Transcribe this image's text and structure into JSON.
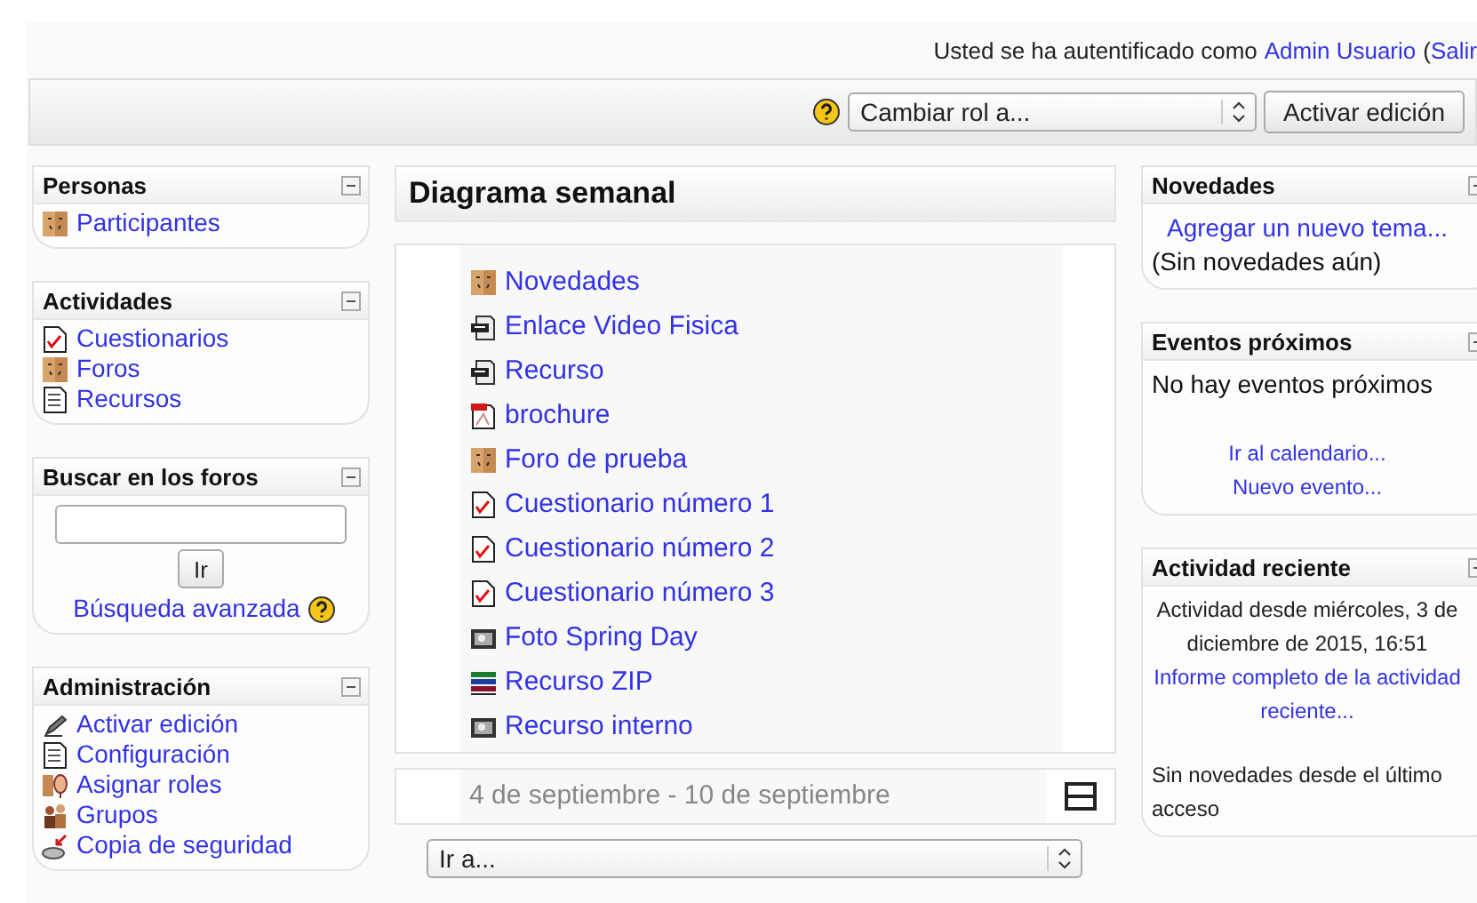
{
  "login": {
    "prefix": "Usted se ha autentificado como",
    "user": "Admin Usuario",
    "paren": "(",
    "logout": "Salir"
  },
  "toolbar": {
    "role_select": "Cambiar rol a...",
    "edit_button": "Activar edición"
  },
  "left_blocks": [
    {
      "title": "Personas",
      "kind": "links",
      "items": [
        {
          "label": "Participantes",
          "kind": "forum"
        }
      ]
    },
    {
      "title": "Actividades",
      "kind": "links",
      "items": [
        {
          "label": "Cuestionarios",
          "kind": "quiz"
        },
        {
          "label": "Foros",
          "kind": "forum"
        },
        {
          "label": "Recursos",
          "kind": "doc"
        }
      ]
    },
    {
      "title": "Buscar en los foros",
      "kind": "search",
      "button": "Ir",
      "link": "Búsqueda avanzada"
    },
    {
      "title": "Administración",
      "kind": "links",
      "items": [
        {
          "label": "Activar edición",
          "kind": "edit"
        },
        {
          "label": "Configuración",
          "kind": "doc"
        },
        {
          "label": "Asignar roles",
          "kind": "roles"
        },
        {
          "label": "Grupos",
          "kind": "groups"
        },
        {
          "label": "Copia de seguridad",
          "kind": "backup"
        }
      ]
    }
  ],
  "center": {
    "title": "Diagrama semanal",
    "items": [
      {
        "label": "Novedades",
        "kind": "forum"
      },
      {
        "label": "Enlace Video Fisica",
        "kind": "link"
      },
      {
        "label": "Recurso",
        "kind": "link"
      },
      {
        "label": "brochure",
        "kind": "pdf"
      },
      {
        "label": "Foro de prueba",
        "kind": "forum"
      },
      {
        "label": "Cuestionario número 1",
        "kind": "quiz"
      },
      {
        "label": "Cuestionario número 2",
        "kind": "quiz"
      },
      {
        "label": "Cuestionario número 3",
        "kind": "quiz"
      },
      {
        "label": "Foto Spring Day",
        "kind": "image"
      },
      {
        "label": "Recurso ZIP",
        "kind": "zip"
      },
      {
        "label": "Recurso interno",
        "kind": "image"
      }
    ],
    "week": "4 de septiembre - 10 de septiembre",
    "jump_select": "Ir a..."
  },
  "right_blocks": [
    {
      "title": "Novedades",
      "lines": [
        {
          "text": "Agregar un nuevo tema...",
          "kind": "link"
        },
        {
          "text": "(Sin novedades aún)",
          "kind": "text"
        }
      ]
    },
    {
      "title": "Eventos próximos",
      "lines": [
        {
          "text": "No hay eventos próximos",
          "kind": "text"
        },
        {
          "text": "Ir al calendario...",
          "kind": "small-link"
        },
        {
          "text": "Nuevo evento...",
          "kind": "small-link"
        }
      ]
    },
    {
      "title": "Actividad reciente",
      "lines": [
        {
          "text": "Actividad desde miércoles, 3 de diciembre de 2015, 16:51",
          "kind": "small-text"
        },
        {
          "text": "Informe completo de la actividad reciente...",
          "kind": "small-link"
        },
        {
          "text": "Sin novedades desde el último acceso",
          "kind": "note"
        }
      ]
    }
  ]
}
